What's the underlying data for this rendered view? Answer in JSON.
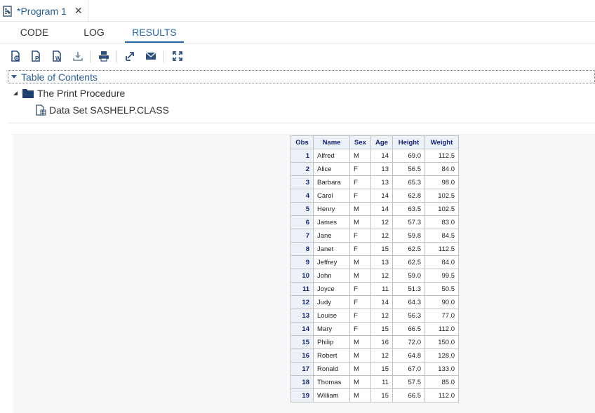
{
  "program_tab": {
    "title": "*Program 1",
    "close_glyph": "✕",
    "icon": "program-doc-icon"
  },
  "subtabs": {
    "code": "CODE",
    "log": "LOG",
    "results": "RESULTS",
    "active": "results"
  },
  "toolbar": [
    {
      "icon": "html-doc-icon"
    },
    {
      "icon": "pdf-doc-icon"
    },
    {
      "icon": "word-doc-icon"
    },
    {
      "icon": "download-icon"
    },
    {
      "icon": "print-icon"
    },
    {
      "icon": "popout-icon"
    },
    {
      "icon": "email-icon"
    },
    {
      "icon": "maximize-icon"
    }
  ],
  "toc": {
    "header": "Table of Contents",
    "procedure": "The Print Procedure",
    "dataset": "Data Set SASHELP.CLASS"
  },
  "table": {
    "headers": [
      "Obs",
      "Name",
      "Sex",
      "Age",
      "Height",
      "Weight"
    ],
    "rows": [
      [
        "1",
        "Alfred",
        "M",
        "14",
        "69.0",
        "112.5"
      ],
      [
        "2",
        "Alice",
        "F",
        "13",
        "56.5",
        "84.0"
      ],
      [
        "3",
        "Barbara",
        "F",
        "13",
        "65.3",
        "98.0"
      ],
      [
        "4",
        "Carol",
        "F",
        "14",
        "62.8",
        "102.5"
      ],
      [
        "5",
        "Henry",
        "M",
        "14",
        "63.5",
        "102.5"
      ],
      [
        "6",
        "James",
        "M",
        "12",
        "57.3",
        "83.0"
      ],
      [
        "7",
        "Jane",
        "F",
        "12",
        "59.8",
        "84.5"
      ],
      [
        "8",
        "Janet",
        "F",
        "15",
        "62.5",
        "112.5"
      ],
      [
        "9",
        "Jeffrey",
        "M",
        "13",
        "62.5",
        "84.0"
      ],
      [
        "10",
        "John",
        "M",
        "12",
        "59.0",
        "99.5"
      ],
      [
        "11",
        "Joyce",
        "F",
        "11",
        "51.3",
        "50.5"
      ],
      [
        "12",
        "Judy",
        "F",
        "14",
        "64.3",
        "90.0"
      ],
      [
        "13",
        "Louise",
        "F",
        "12",
        "56.3",
        "77.0"
      ],
      [
        "14",
        "Mary",
        "F",
        "15",
        "66.5",
        "112.0"
      ],
      [
        "15",
        "Philip",
        "M",
        "16",
        "72.0",
        "150.0"
      ],
      [
        "16",
        "Robert",
        "M",
        "12",
        "64.8",
        "128.0"
      ],
      [
        "17",
        "Ronald",
        "M",
        "15",
        "67.0",
        "133.0"
      ],
      [
        "18",
        "Thomas",
        "M",
        "11",
        "57.5",
        "85.0"
      ],
      [
        "19",
        "William",
        "M",
        "15",
        "66.5",
        "112.0"
      ]
    ]
  },
  "colors": {
    "accent": "#2a6aaa",
    "header_bg": "#edf2f9",
    "header_text": "#112277",
    "icon": "#2f4f7f"
  }
}
